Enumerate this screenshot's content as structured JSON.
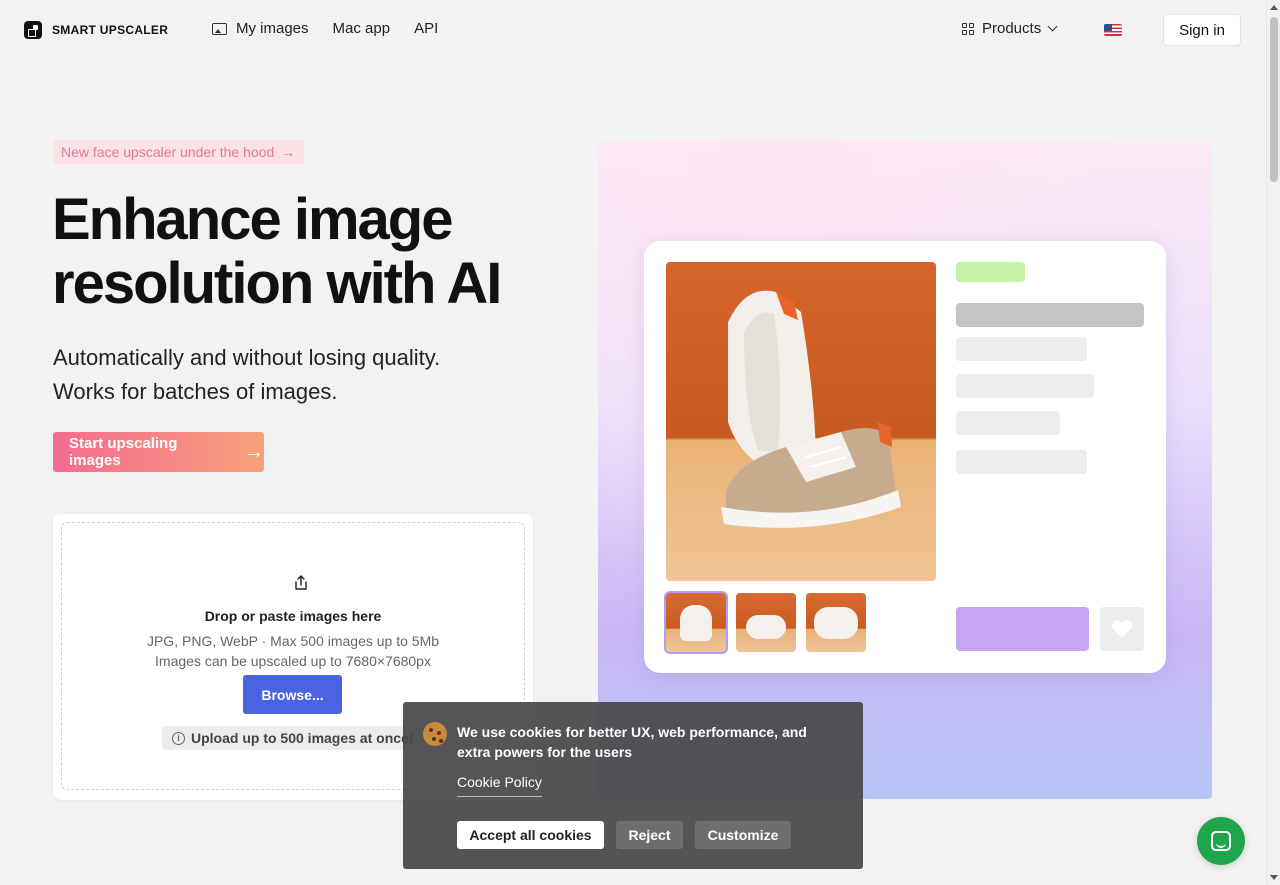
{
  "header": {
    "logo_text": "SMART UPSCALER",
    "nav": [
      {
        "label": "My images"
      },
      {
        "label": "Mac app"
      },
      {
        "label": "API"
      }
    ],
    "products_label": "Products",
    "language": "en-US",
    "signin_label": "Sign in"
  },
  "hero": {
    "badge": "New face upscaler under the hood",
    "title_line1": "Enhance image",
    "title_line2": "resolution with AI",
    "subtitle_line1": "Automatically and without losing quality.",
    "subtitle_line2": "Works for batches of images.",
    "cta_label": "Start upscaling images"
  },
  "upload": {
    "title": "Drop or paste images here",
    "formats": "JPG, PNG, WebP · Max 500 images up to 5Mb",
    "limit": "Images can be upscaled up to 7680×7680px",
    "browse_label": "Browse...",
    "batch_note": "Upload up to 500 images at once!"
  },
  "cookie": {
    "message": "We use cookies for better UX, web performance, and extra powers for the users",
    "policy_link": "Cookie Policy",
    "accept_label": "Accept all cookies",
    "reject_label": "Reject",
    "customize_label": "Customize"
  },
  "colors": {
    "cta_gradient_start": "#f56b8f",
    "cta_gradient_end": "#f7a07a",
    "browse": "#4a63e0",
    "chat": "#1fa64a",
    "badge_text": "#e37a95"
  }
}
